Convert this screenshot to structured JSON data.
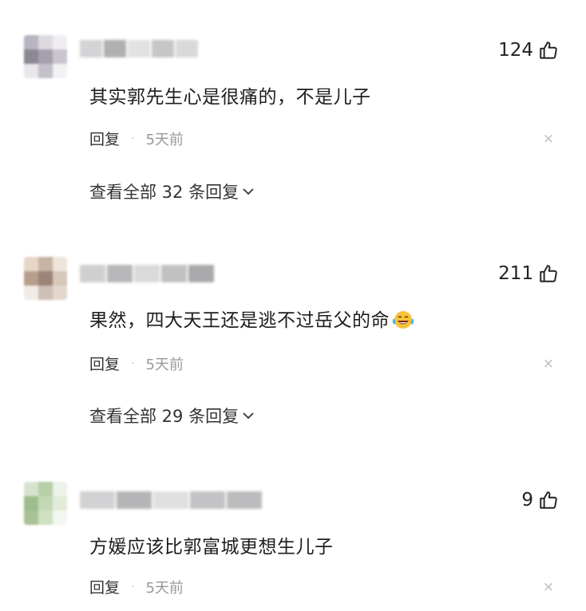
{
  "comments": [
    {
      "likes": "124",
      "text": "其实郭先生心是很痛的，不是儿子",
      "reply_label": "回复",
      "time": "5天前",
      "view_replies": "查看全部 32 条回复",
      "avatar_colors": [
        "#b9b3c2",
        "#ddd9e0",
        "#efedf1",
        "#8d8794",
        "#a6a0ad",
        "#c9c5cf",
        "#e8e6ea",
        "#c4c0c9",
        "#f2f1f3"
      ],
      "name_colors": [
        "#d4d4d6",
        "#b0b0b2",
        "#e2e2e3",
        "#c6c6c8",
        "#d9d9da"
      ]
    },
    {
      "likes": "211",
      "text": "果然，四大天王还是逃不过岳父的命",
      "emoji": "laughing-tears-emoji",
      "reply_label": "回复",
      "time": "5天前",
      "view_replies": "查看全部 29 条回复",
      "avatar_colors": [
        "#e6d6c6",
        "#c7b4a2",
        "#ede5dc",
        "#b89f8c",
        "#9a8577",
        "#d8c8ba",
        "#f1ebe6",
        "#cdbfb3",
        "#e2d7cd"
      ],
      "name_colors": [
        "#cfcfd1",
        "#b7b7b9",
        "#dadadb",
        "#c1c1c3",
        "#a9a9ab"
      ]
    },
    {
      "likes": "9",
      "text": "方媛应该比郭富城更想生儿子",
      "reply_label": "回复",
      "time": "5天前",
      "avatar_colors": [
        "#d7e3cf",
        "#b8cfa8",
        "#eef3ea",
        "#9fbd8c",
        "#c4d8b6",
        "#e1ebda",
        "#a8c295",
        "#cfe0c3",
        "#f3f7f0"
      ],
      "name_colors": [
        "#d2d2d4",
        "#b5b5b7",
        "#e0e0e1",
        "#c3c3c5",
        "#bcbcbe"
      ]
    }
  ],
  "icons": {
    "like": "thumbs-up-icon",
    "close": "close-icon",
    "expand": "chevron-down-icon"
  },
  "close_glyph": "×"
}
